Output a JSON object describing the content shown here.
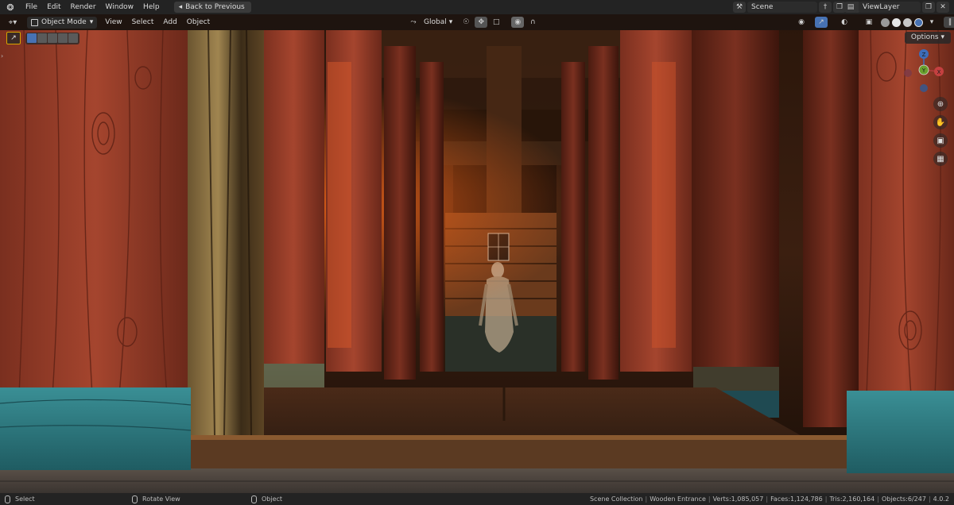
{
  "topbar": {
    "menus": [
      "File",
      "Edit",
      "Render",
      "Window",
      "Help"
    ],
    "back_label": "Back to Previous",
    "scene_name": "Scene",
    "view_layer_name": "ViewLayer"
  },
  "viewport_header": {
    "mode": "Object Mode",
    "menus": [
      "View",
      "Select",
      "Add",
      "Object"
    ],
    "transform_orientation": "Global",
    "options_label": "Options"
  },
  "gizmo": {
    "x_label": "X",
    "y_label": "Y",
    "z_label": "Z"
  },
  "statusbar": {
    "hints": [
      "Select",
      "Rotate View",
      "Object"
    ],
    "collection": "Scene Collection",
    "object_name": "Wooden Entrance",
    "verts": "Verts:1,085,057",
    "faces": "Faces:1,124,786",
    "tris": "Tris:2,160,164",
    "objects": "Objects:6/247",
    "version": "4.0.2"
  },
  "colors": {
    "accent": "#4772b3",
    "active_tool_border": "#d7a400",
    "pillar_red": "#8e3a28",
    "teal_base": "#2f7f86"
  }
}
